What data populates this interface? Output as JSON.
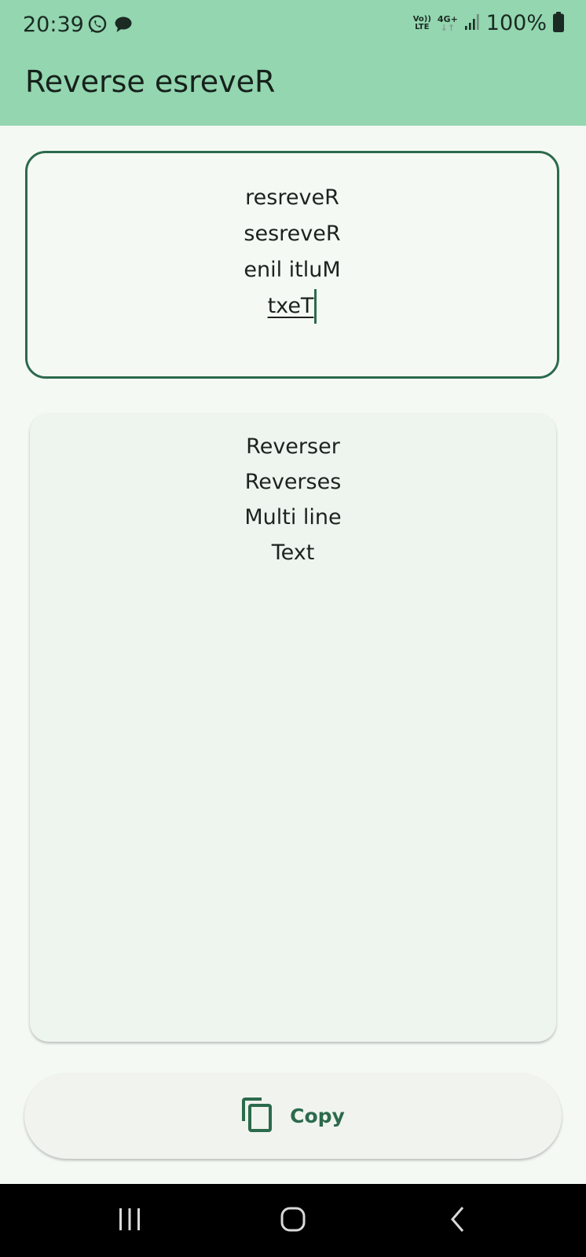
{
  "status_bar": {
    "time": "20:39",
    "volte_top": "Vo))",
    "volte_bottom": "LTE",
    "network_type": "4G+",
    "network_arrows": "↓↑",
    "battery_percent": "100%",
    "icons": [
      "whatsapp-icon",
      "chat-bubble-icon",
      "volte-icon",
      "signal-icon",
      "battery-icon"
    ]
  },
  "app_bar": {
    "title": "Reverse esreveR"
  },
  "input": {
    "lines": [
      "resreveR",
      "sesreveR",
      "enil itluM",
      "txeT"
    ]
  },
  "output": {
    "lines": [
      "Reverser",
      "Reverses",
      "Multi line",
      "Text"
    ]
  },
  "copy_button": {
    "label": "Copy",
    "icon": "copy-icon"
  },
  "nav_bar": {
    "icons": [
      "recent-apps-icon",
      "home-icon",
      "back-icon"
    ]
  },
  "colors": {
    "app_bar": "#93d6b0",
    "accent": "#2c6a4c",
    "background": "#f5f9f4",
    "output_card": "#eef4ee",
    "nav_bar": "#000000"
  }
}
